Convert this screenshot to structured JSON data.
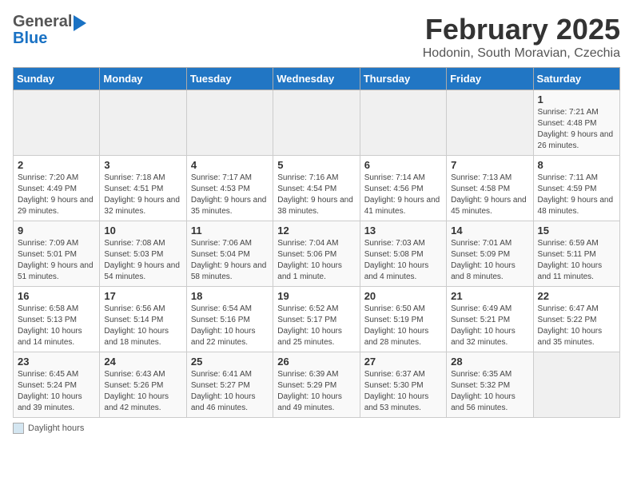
{
  "header": {
    "logo_general": "General",
    "logo_blue": "Blue",
    "title": "February 2025",
    "subtitle": "Hodonin, South Moravian, Czechia"
  },
  "weekdays": [
    "Sunday",
    "Monday",
    "Tuesday",
    "Wednesday",
    "Thursday",
    "Friday",
    "Saturday"
  ],
  "weeks": [
    [
      {
        "day": "",
        "info": ""
      },
      {
        "day": "",
        "info": ""
      },
      {
        "day": "",
        "info": ""
      },
      {
        "day": "",
        "info": ""
      },
      {
        "day": "",
        "info": ""
      },
      {
        "day": "",
        "info": ""
      },
      {
        "day": "1",
        "info": "Sunrise: 7:21 AM\nSunset: 4:48 PM\nDaylight: 9 hours and 26 minutes."
      }
    ],
    [
      {
        "day": "2",
        "info": "Sunrise: 7:20 AM\nSunset: 4:49 PM\nDaylight: 9 hours and 29 minutes."
      },
      {
        "day": "3",
        "info": "Sunrise: 7:18 AM\nSunset: 4:51 PM\nDaylight: 9 hours and 32 minutes."
      },
      {
        "day": "4",
        "info": "Sunrise: 7:17 AM\nSunset: 4:53 PM\nDaylight: 9 hours and 35 minutes."
      },
      {
        "day": "5",
        "info": "Sunrise: 7:16 AM\nSunset: 4:54 PM\nDaylight: 9 hours and 38 minutes."
      },
      {
        "day": "6",
        "info": "Sunrise: 7:14 AM\nSunset: 4:56 PM\nDaylight: 9 hours and 41 minutes."
      },
      {
        "day": "7",
        "info": "Sunrise: 7:13 AM\nSunset: 4:58 PM\nDaylight: 9 hours and 45 minutes."
      },
      {
        "day": "8",
        "info": "Sunrise: 7:11 AM\nSunset: 4:59 PM\nDaylight: 9 hours and 48 minutes."
      }
    ],
    [
      {
        "day": "9",
        "info": "Sunrise: 7:09 AM\nSunset: 5:01 PM\nDaylight: 9 hours and 51 minutes."
      },
      {
        "day": "10",
        "info": "Sunrise: 7:08 AM\nSunset: 5:03 PM\nDaylight: 9 hours and 54 minutes."
      },
      {
        "day": "11",
        "info": "Sunrise: 7:06 AM\nSunset: 5:04 PM\nDaylight: 9 hours and 58 minutes."
      },
      {
        "day": "12",
        "info": "Sunrise: 7:04 AM\nSunset: 5:06 PM\nDaylight: 10 hours and 1 minute."
      },
      {
        "day": "13",
        "info": "Sunrise: 7:03 AM\nSunset: 5:08 PM\nDaylight: 10 hours and 4 minutes."
      },
      {
        "day": "14",
        "info": "Sunrise: 7:01 AM\nSunset: 5:09 PM\nDaylight: 10 hours and 8 minutes."
      },
      {
        "day": "15",
        "info": "Sunrise: 6:59 AM\nSunset: 5:11 PM\nDaylight: 10 hours and 11 minutes."
      }
    ],
    [
      {
        "day": "16",
        "info": "Sunrise: 6:58 AM\nSunset: 5:13 PM\nDaylight: 10 hours and 14 minutes."
      },
      {
        "day": "17",
        "info": "Sunrise: 6:56 AM\nSunset: 5:14 PM\nDaylight: 10 hours and 18 minutes."
      },
      {
        "day": "18",
        "info": "Sunrise: 6:54 AM\nSunset: 5:16 PM\nDaylight: 10 hours and 22 minutes."
      },
      {
        "day": "19",
        "info": "Sunrise: 6:52 AM\nSunset: 5:17 PM\nDaylight: 10 hours and 25 minutes."
      },
      {
        "day": "20",
        "info": "Sunrise: 6:50 AM\nSunset: 5:19 PM\nDaylight: 10 hours and 28 minutes."
      },
      {
        "day": "21",
        "info": "Sunrise: 6:49 AM\nSunset: 5:21 PM\nDaylight: 10 hours and 32 minutes."
      },
      {
        "day": "22",
        "info": "Sunrise: 6:47 AM\nSunset: 5:22 PM\nDaylight: 10 hours and 35 minutes."
      }
    ],
    [
      {
        "day": "23",
        "info": "Sunrise: 6:45 AM\nSunset: 5:24 PM\nDaylight: 10 hours and 39 minutes."
      },
      {
        "day": "24",
        "info": "Sunrise: 6:43 AM\nSunset: 5:26 PM\nDaylight: 10 hours and 42 minutes."
      },
      {
        "day": "25",
        "info": "Sunrise: 6:41 AM\nSunset: 5:27 PM\nDaylight: 10 hours and 46 minutes."
      },
      {
        "day": "26",
        "info": "Sunrise: 6:39 AM\nSunset: 5:29 PM\nDaylight: 10 hours and 49 minutes."
      },
      {
        "day": "27",
        "info": "Sunrise: 6:37 AM\nSunset: 5:30 PM\nDaylight: 10 hours and 53 minutes."
      },
      {
        "day": "28",
        "info": "Sunrise: 6:35 AM\nSunset: 5:32 PM\nDaylight: 10 hours and 56 minutes."
      },
      {
        "day": "",
        "info": ""
      }
    ]
  ],
  "legend": {
    "label": "Daylight hours"
  }
}
